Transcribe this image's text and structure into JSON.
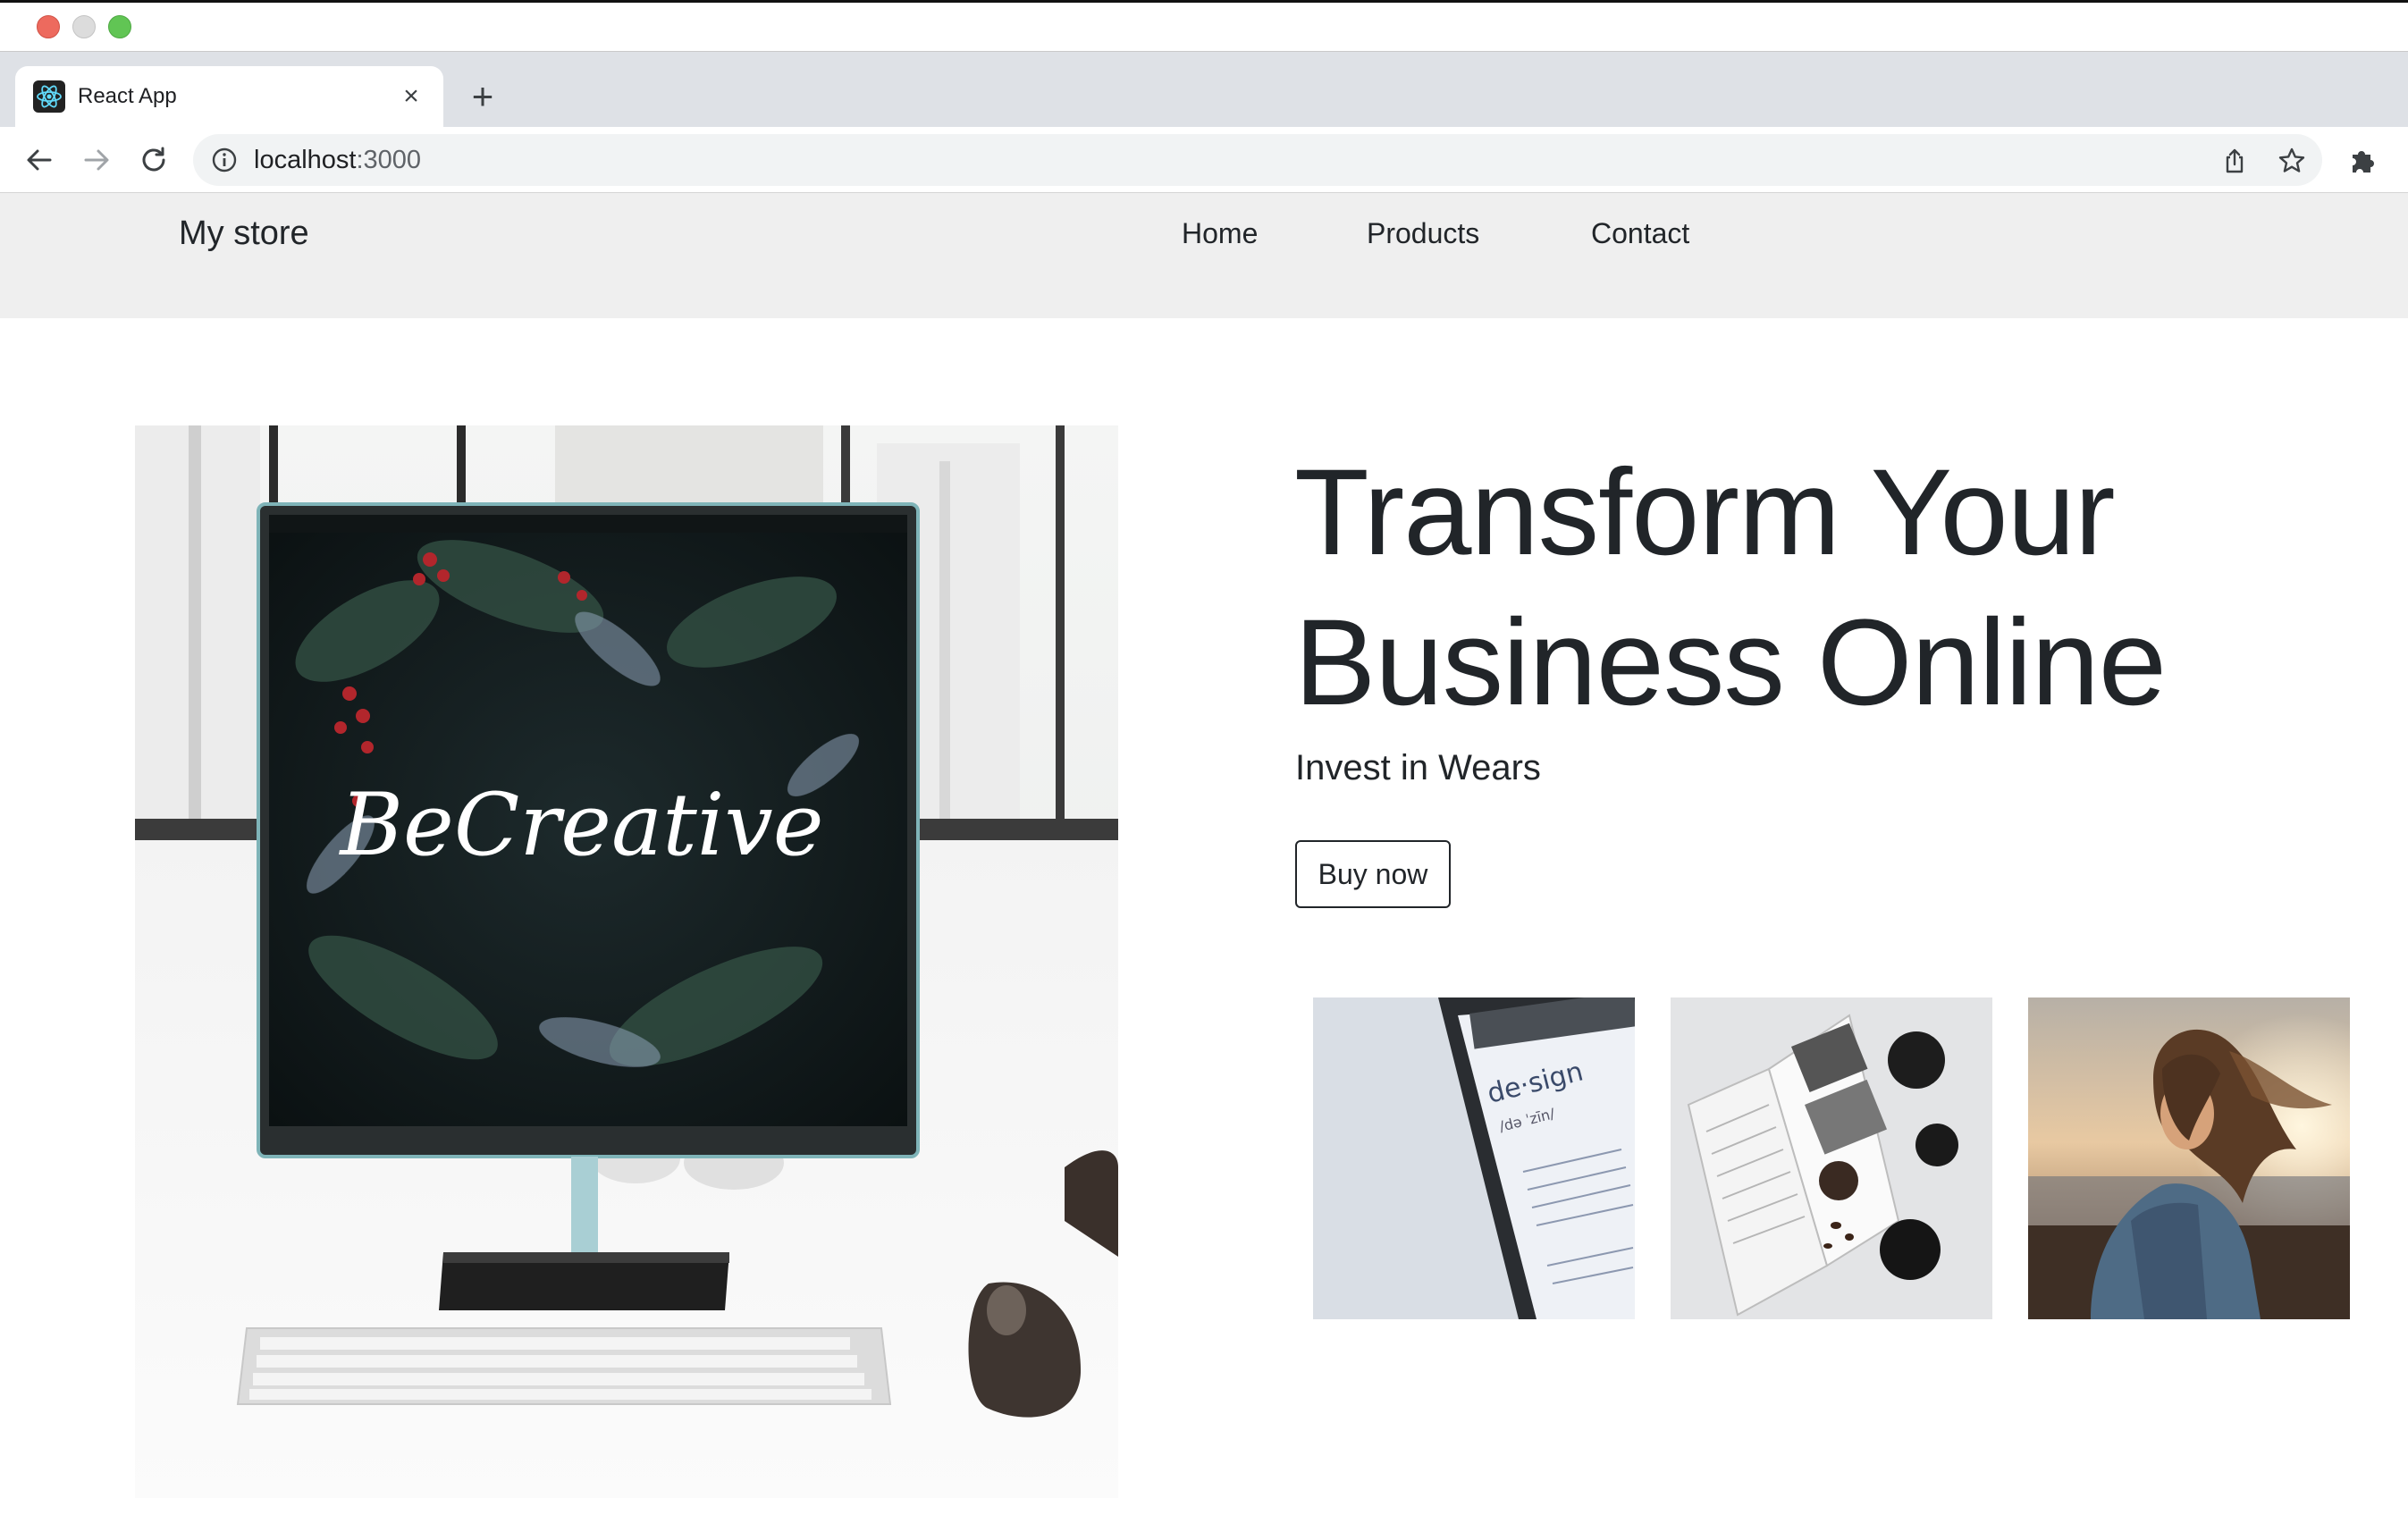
{
  "browser": {
    "tab_title": "React App",
    "tab_close": "×",
    "new_tab": "+",
    "url_host": "localhost",
    "url_port": ":3000"
  },
  "navbar": {
    "brand": "My store",
    "links": [
      {
        "label": "Home"
      },
      {
        "label": "Products"
      },
      {
        "label": "Contact"
      }
    ]
  },
  "hero": {
    "headline_line1": "Transform Your",
    "headline_line2": "Business Online",
    "tagline": "Invest in Wears",
    "cta_label": "Buy now",
    "screen_lettering": "BeCreative"
  },
  "thumbnails": {
    "design_word": "de·sign",
    "design_phonetic": "/də ˈzīn/"
  }
}
